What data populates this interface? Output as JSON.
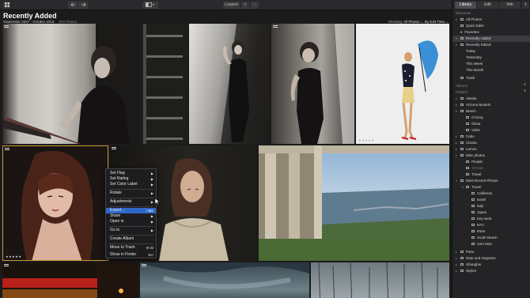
{
  "toolbar": {
    "zoom_label": "Largest",
    "zoom_plus": "+",
    "zoom_minus": "−"
  },
  "header": {
    "title": "Recently Added",
    "date_range": "September 2007 - October 2018",
    "photo_count": "500 Photos",
    "showing_label": "Showing:",
    "showing_value": "All Photos",
    "sort_label": "By Edit Time"
  },
  "photos": {
    "stars": "★★★★★"
  },
  "context_menu": {
    "items": [
      {
        "label": "Set Flag",
        "arrow": "▶"
      },
      {
        "label": "Set Rating",
        "arrow": "▶"
      },
      {
        "label": "Set Color Label",
        "arrow": "▶"
      },
      {
        "label": "Rotate",
        "arrow": "▶"
      },
      {
        "label": "Adjustments",
        "arrow": "▶"
      },
      {
        "label": "Export...",
        "shortcut": "⇧⌘E"
      },
      {
        "label": "Share",
        "arrow": "▶"
      },
      {
        "label": "Open in",
        "arrow": "▶"
      },
      {
        "label": "Go to",
        "arrow": "▶"
      },
      {
        "label": "Create Album"
      },
      {
        "label": "Move to Trash",
        "shortcut": "⌘⌫"
      },
      {
        "label": "Show in Finder",
        "shortcut": "⌘R"
      }
    ],
    "highlight_color": "#2e67c9"
  },
  "sidebar": {
    "tabs": [
      "Library",
      "Edit",
      "Info"
    ],
    "shortcuts_header": "Shortcuts",
    "shortcuts": [
      "All Photos",
      "Quick Edits",
      "Favorites",
      "Recently Added",
      "Recently Edited",
      "Today",
      "Yesterday",
      "This Week",
      "This Month",
      "Trash"
    ],
    "albums_header": "Albums",
    "folders_header": "Folders",
    "folders": [
      "Alaska",
      "Arizona Models",
      "Beach",
      "Chrissy",
      "Olivia",
      "Vinks",
      "Cabo",
      "Classic",
      "Lemon",
      "Misc photos",
      "People",
      "SCUBA",
      "Travel",
      "Most Recent Photos",
      "Travel",
      "California",
      "Israel",
      "Italy",
      "Japan",
      "Key west",
      "NYC",
      "Paris",
      "South Beach",
      "USA Misc",
      "Paris",
      "Rate and Organize",
      "Shanghai",
      "Stylize"
    ],
    "plus": "+"
  },
  "colors": {
    "accent": "#2e67c9",
    "background": "#1b1b1c",
    "sidebar": "#242426"
  }
}
